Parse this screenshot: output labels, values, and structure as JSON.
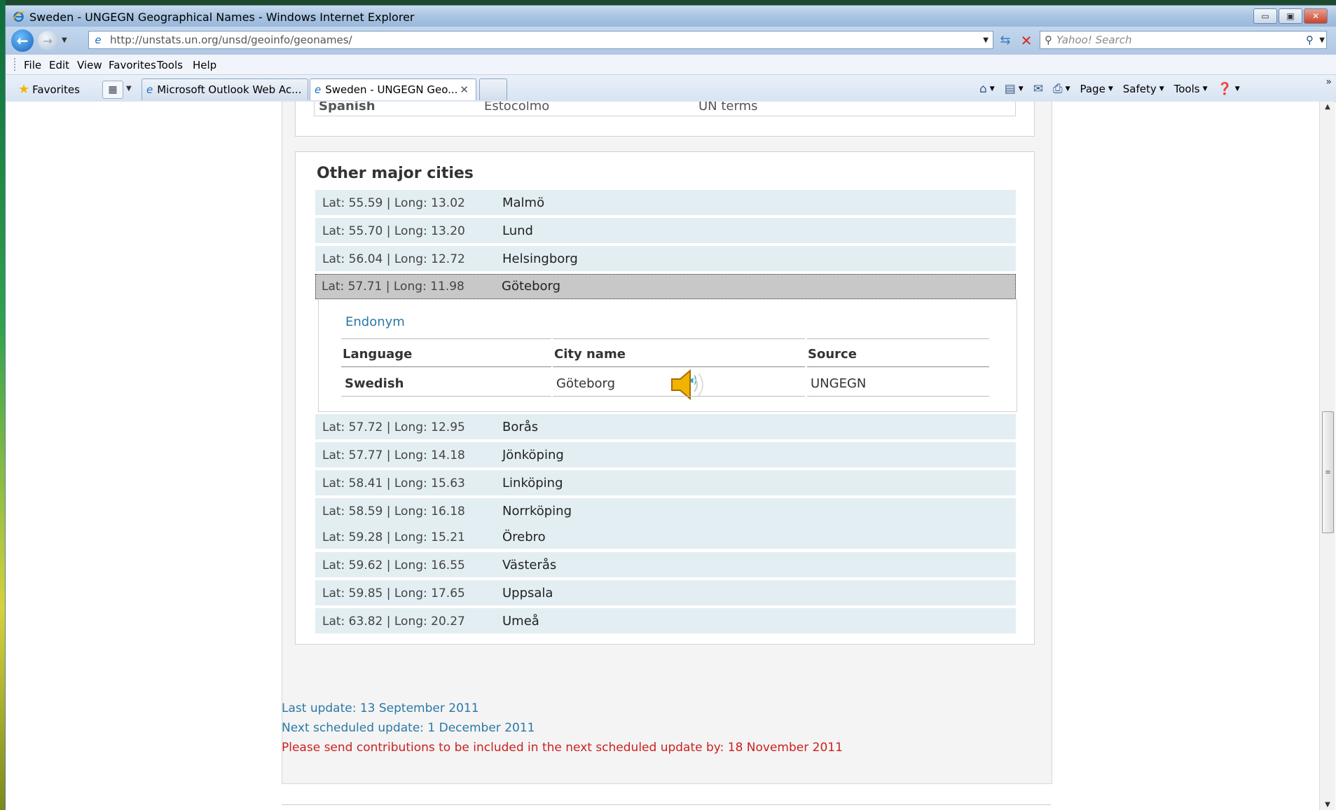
{
  "window": {
    "title": "Sweden - UNGEGN Geographical Names - Windows Internet Explorer",
    "buttons": [
      "▭",
      "▣",
      "✕"
    ]
  },
  "address": {
    "url": "http://unstats.un.org/unsd/geoinfo/geonames/",
    "search_placeholder": "Yahoo! Search"
  },
  "menu": [
    "File",
    "Edit",
    "View",
    "Favorites",
    "Tools",
    "Help"
  ],
  "favorites_label": "Favorites",
  "tabs": [
    {
      "label": "Microsoft Outlook Web Ac..."
    },
    {
      "label": "Sweden - UNGEGN Geo..."
    }
  ],
  "commandbar": {
    "page": "Page",
    "safety": "Safety",
    "tools": "Tools"
  },
  "previous_row": {
    "language": "Spanish",
    "name": "Estocolmo",
    "source": "UN terms"
  },
  "cities_section": {
    "title": "Other major cities",
    "cities": [
      {
        "coord": "Lat: 55.59 | Long: 13.02",
        "name": "Malmö"
      },
      {
        "coord": "Lat: 55.70 | Long: 13.20",
        "name": "Lund"
      },
      {
        "coord": "Lat: 56.04 | Long: 12.72",
        "name": "Helsingborg"
      },
      {
        "coord": "Lat: 57.71 | Long: 11.98",
        "name": "Göteborg"
      },
      {
        "coord": "Lat: 57.72 | Long: 12.95",
        "name": "Borås"
      },
      {
        "coord": "Lat: 57.77 | Long: 14.18",
        "name": "Jönköping"
      },
      {
        "coord": "Lat: 58.41 | Long: 15.63",
        "name": "Linköping"
      },
      {
        "coord": "Lat: 58.59 | Long: 16.18",
        "name": "Norrköping"
      },
      {
        "coord": "Lat: 59.28 | Long: 15.21",
        "name": "Örebro"
      },
      {
        "coord": "Lat: 59.62 | Long: 16.55",
        "name": "Västerås"
      },
      {
        "coord": "Lat: 59.85 | Long: 17.65",
        "name": "Uppsala"
      },
      {
        "coord": "Lat: 63.82 | Long: 20.27",
        "name": "Umeå"
      }
    ],
    "selected_index": 3
  },
  "endonym": {
    "title": "Endonym",
    "headers": [
      "Language",
      "City name",
      "Source"
    ],
    "row": {
      "language": "Swedish",
      "city": "Göteborg",
      "source": "UNGEGN"
    }
  },
  "footer": {
    "last_update": "Last update: 13 September 2011",
    "next_update": "Next scheduled update: 1 December 2011",
    "contributions": "Please send contributions to be included in the next scheduled update by: 18 November 2011"
  }
}
